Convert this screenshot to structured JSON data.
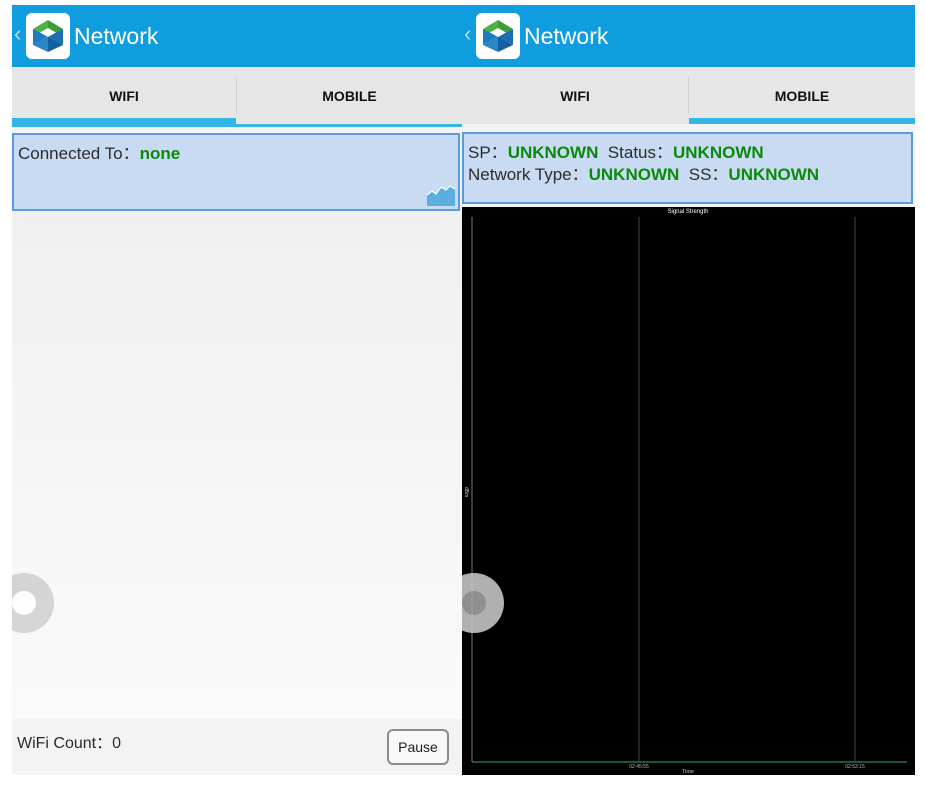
{
  "left": {
    "header": {
      "back_glyph": "‹",
      "title": "Network"
    },
    "tabs": [
      {
        "label": "WIFI",
        "active": true
      },
      {
        "label": "MOBILE",
        "active": false
      }
    ],
    "connection": {
      "label": "Connected To：",
      "value": "none"
    },
    "footer": {
      "wifi_count_label": "WiFi Count：",
      "wifi_count_value": "0",
      "pause_label": "Pause"
    }
  },
  "right": {
    "header": {
      "back_glyph": "‹",
      "title": "Network"
    },
    "tabs": [
      {
        "label": "WIFI",
        "active": false
      },
      {
        "label": "MOBILE",
        "active": true
      }
    ],
    "mobile_info": {
      "sp_label": "SP：",
      "sp_value": "UNKNOWN",
      "status_label": "Status：",
      "status_value": "UNKNOWN",
      "network_type_label": "Network Type：",
      "network_type_value": "UNKNOWN",
      "ss_label": "SS：",
      "ss_value": "UNKNOWN"
    },
    "chart_data": {
      "type": "line",
      "title": "Signal Strength",
      "xlabel": "Time",
      "ylabel": "dBm",
      "x_ticks": [
        "02:45:55",
        "02:53:15"
      ],
      "series": [],
      "background": "#000000",
      "grid": true
    }
  },
  "colors": {
    "actionbar": "#0f9ddf",
    "tab_indicator": "#33b5e5",
    "card_bg": "#c8dbf2",
    "card_border": "#5b9bd8",
    "value_green": "#0a8a0a"
  },
  "icons": {
    "back": "chevron-left-icon",
    "app": "app-logo-icon",
    "graph": "area-graph-icon",
    "float": "floating-handle-icon"
  }
}
